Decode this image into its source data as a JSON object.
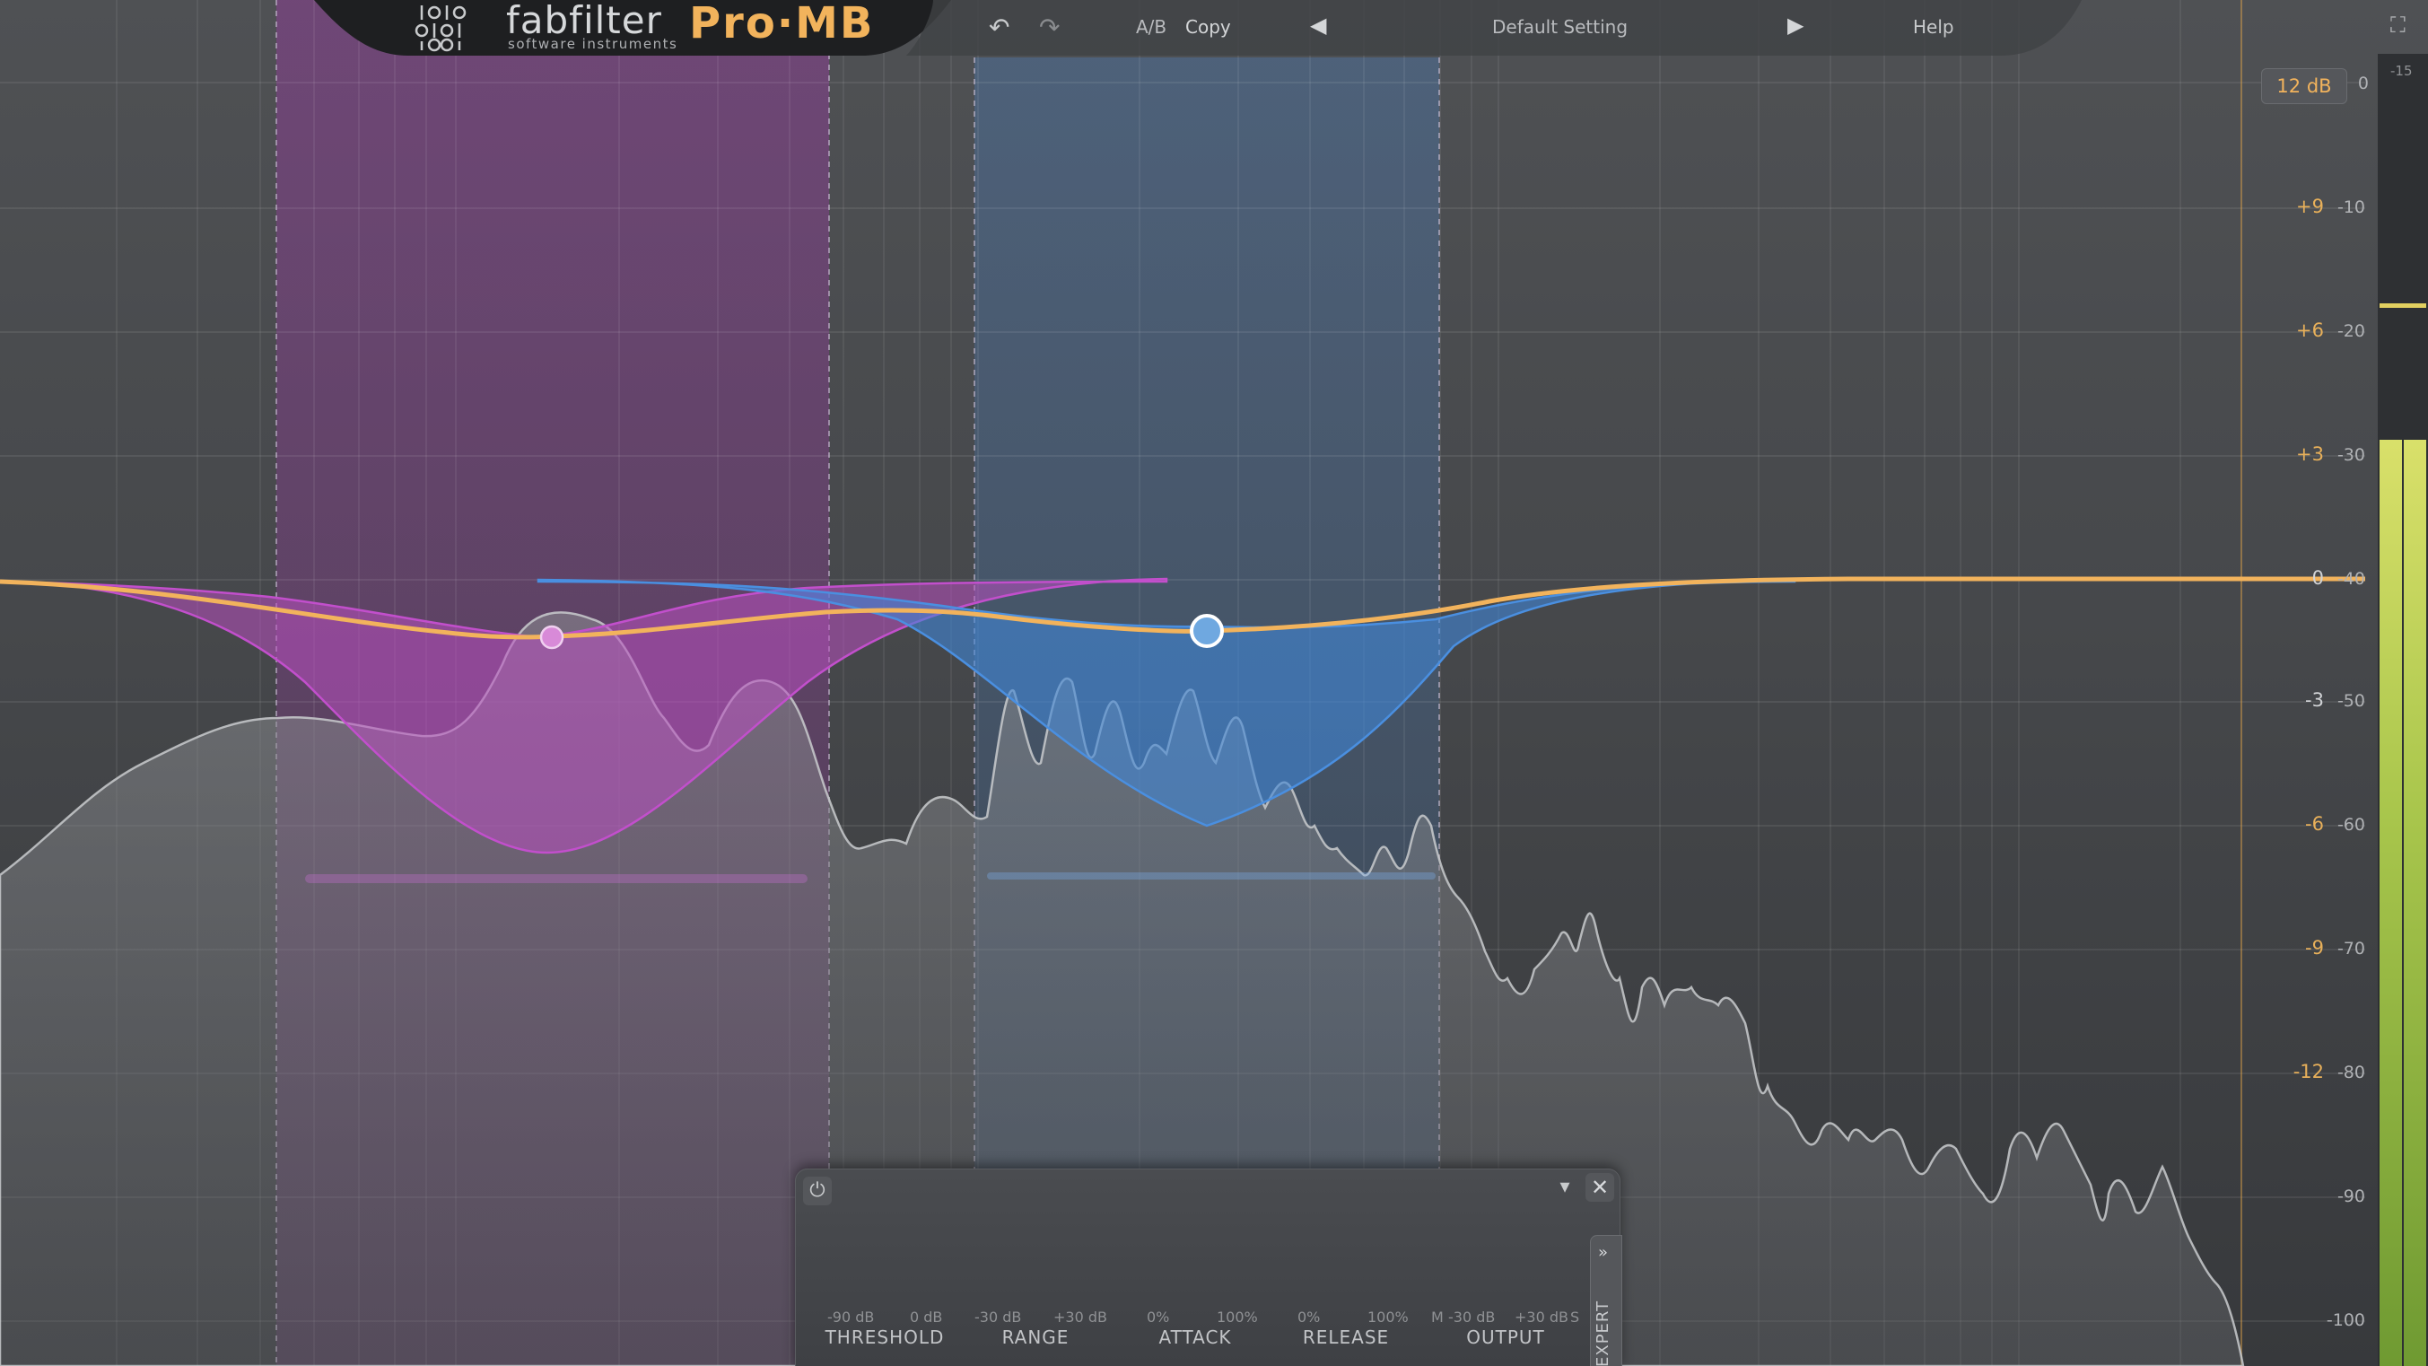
{
  "header": {
    "brand": "fabfilter",
    "brand_sub": "software instruments",
    "product": "Pro·MB",
    "ab_label": "A/B",
    "copy_label": "Copy",
    "preset_name": "Default Setting",
    "help_label": "Help"
  },
  "display_range": "12 dB",
  "gain_scale": [
    "+9",
    "+6",
    "+3",
    "0",
    "-3",
    "-6",
    "-9",
    "-12"
  ],
  "level_scale": [
    "0",
    "-10",
    "-20",
    "-30",
    "-40",
    "-50",
    "-60",
    "-70",
    "-80",
    "-90",
    "-100"
  ],
  "meter_top_label": "-15",
  "band_panel": {
    "knobs": [
      {
        "label": "THRESHOLD",
        "min": "-90 dB",
        "max": "0 dB"
      },
      {
        "label": "RANGE",
        "min": "-30 dB",
        "max": "+30 dB"
      },
      {
        "label": "ATTACK",
        "min": "0%",
        "max": "100%"
      },
      {
        "label": "RELEASE",
        "min": "0%",
        "max": "100%"
      },
      {
        "label": "OUTPUT",
        "min": "-30 dB",
        "max": "+30 dB",
        "left_tag": "M",
        "right_tag": "S"
      }
    ],
    "expert_label": "EXPERT"
  },
  "colors": {
    "accent_orange": "#f2b35c",
    "band1": "#b04bb8",
    "band2": "#4a82c8",
    "meter_green": "#9fc24a"
  }
}
